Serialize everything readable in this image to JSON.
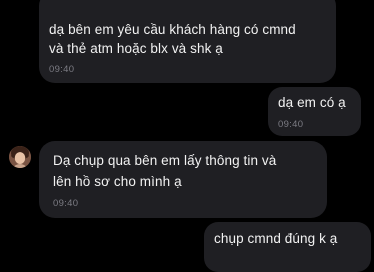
{
  "messages": [
    {
      "direction": "incoming",
      "lines": [
        "dạ bên em yêu cầu khách hàng có cmnd",
        "và thẻ atm hoặc blx và shk ạ"
      ],
      "time": "09:40"
    },
    {
      "direction": "outgoing",
      "lines": [
        "dạ em có ạ"
      ],
      "time": "09:40"
    },
    {
      "direction": "incoming",
      "lines": [
        "Dạ chụp qua bên em lấy thông tin và",
        "lên hồ sơ cho mình ạ"
      ],
      "time": "09:40"
    },
    {
      "direction": "outgoing",
      "lines": [
        "chụp cmnd đúng k ạ"
      ],
      "time": ""
    }
  ],
  "colors": {
    "background": "#000000",
    "bubble": "#1f1f23",
    "text": "#f2f2f2",
    "timestamp": "#7c7c84"
  }
}
